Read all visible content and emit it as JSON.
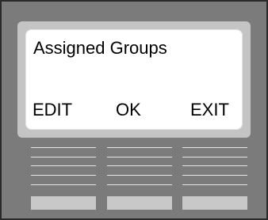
{
  "screen": {
    "title": "Assigned Groups",
    "softkeys": [
      {
        "label": "EDIT"
      },
      {
        "label": "OK"
      },
      {
        "label": "EXIT"
      }
    ]
  },
  "colors": {
    "housing": "#7b7b7b",
    "bezel": "#c4c4c4",
    "lcd_background": "#ffffff",
    "text": "#000000",
    "key_lines": "#e6e6e6",
    "key_buttons": "#c8c8c8"
  }
}
